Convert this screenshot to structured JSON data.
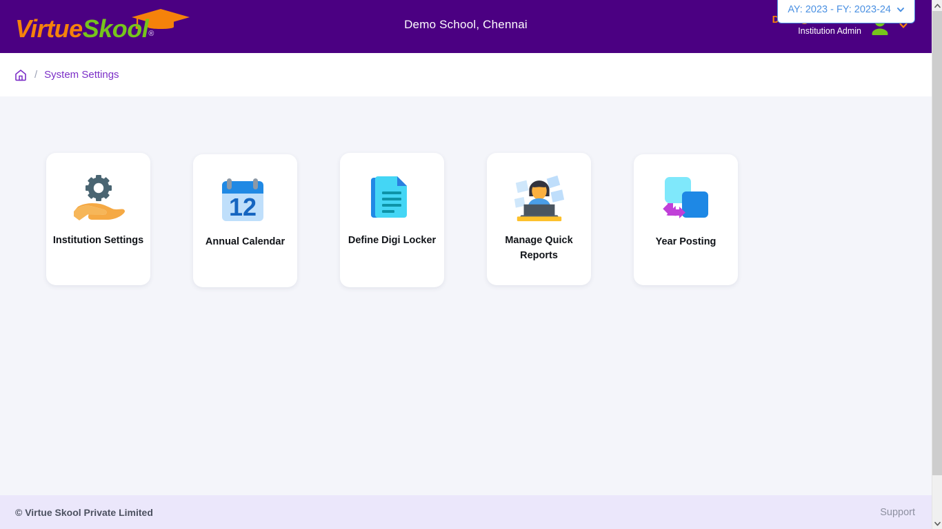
{
  "header": {
    "logo": {
      "part1": "Virtue",
      "part2": "Skool",
      "registered": "®",
      "cap_icon": "graduation-cap-icon"
    },
    "school_title": "Demo School, Chennai",
    "user": {
      "email": "Demo@Email.Com",
      "role": "Institution Admin",
      "avatar_icon": "user-avatar-icon",
      "caret_icon": "chevron-down-icon"
    },
    "colors": {
      "bar": "#4b0082",
      "logo_orange": "#f5820b",
      "logo_green": "#76c51c"
    }
  },
  "breadcrumb": {
    "home_icon": "home-icon",
    "separator": "/",
    "current": "System Settings"
  },
  "year_selector": {
    "label": "AY: 2023 - FY: 2023-24",
    "caret_icon": "chevron-down-icon",
    "accent": "#4a90e2"
  },
  "main": {
    "cards": [
      {
        "label": "Institution Settings",
        "icon": "gear-in-hand-icon"
      },
      {
        "label": "Annual Calendar",
        "icon": "calendar-icon",
        "calendar_day": "12"
      },
      {
        "label": "Define Digi Locker",
        "icon": "documents-icon"
      },
      {
        "label": "Manage Quick Reports",
        "icon": "person-at-laptop-icon"
      },
      {
        "label": "Year Posting",
        "icon": "two-squares-arrow-icon"
      }
    ]
  },
  "footer": {
    "copyright": "© Virtue Skool Private Limited",
    "support": "Support"
  },
  "scrollbar": {
    "up_icon": "chevron-up-icon",
    "down_icon": "chevron-down-icon"
  }
}
